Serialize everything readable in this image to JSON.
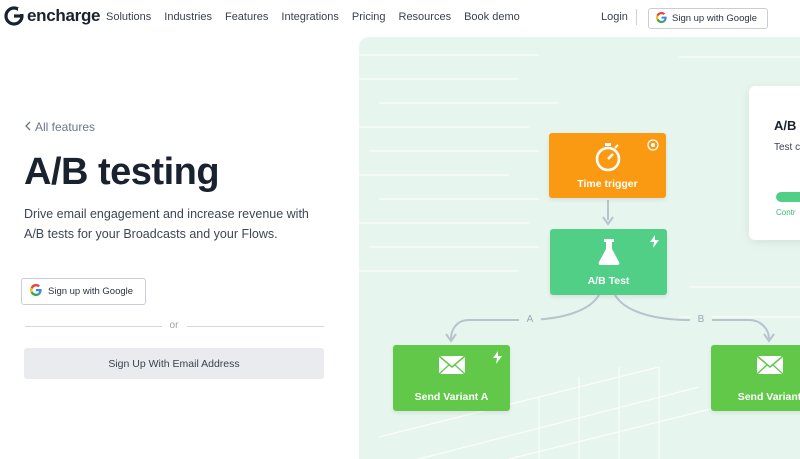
{
  "nav": {
    "logo_text": "encharge",
    "links": [
      "Solutions",
      "Industries",
      "Features",
      "Integrations",
      "Pricing",
      "Resources",
      "Book demo"
    ],
    "login": "Login",
    "google_signup": "Sign up with Google"
  },
  "hero": {
    "back_link": "All features",
    "title": "A/B testing",
    "description": "Drive email engagement and increase revenue with A/B tests for your Broadcasts and your Flows.",
    "google_signup": "Sign up with Google",
    "or": "or",
    "email_signup": "Sign Up With Email Address"
  },
  "flow": {
    "time_trigger": "Time trigger",
    "ab_test": "A/B Test",
    "branch_a": "A",
    "branch_b": "B",
    "variant_a": "Send Variant A",
    "variant_b": "Send Variant",
    "side_card": {
      "title": "A/B",
      "subtitle": "Test c",
      "cont": "Contr"
    }
  },
  "colors": {
    "orange_node": "#fa9a12",
    "ab_node": "#52cf87",
    "variant_node": "#62c84a",
    "panel_bg": "#e7f5ef"
  },
  "icons": {
    "logo": "encharge-logo-icon",
    "google": "google-g-icon",
    "back": "chevron-left-icon",
    "stopwatch": "stopwatch-icon",
    "target": "target-icon",
    "flask": "flask-icon",
    "bolt": "lightning-icon",
    "mail": "envelope-icon"
  }
}
